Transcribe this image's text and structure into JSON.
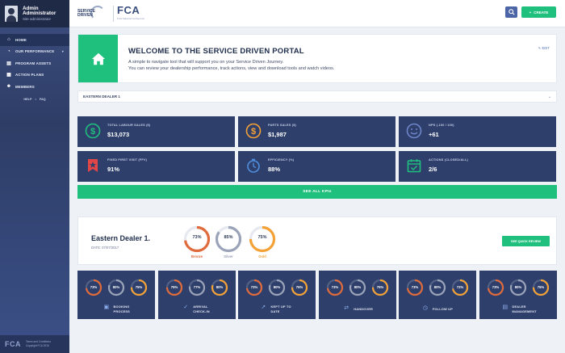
{
  "sidebar": {
    "user_name_line1": "Admin",
    "user_name_line2": "Administrator",
    "user_role": "Site administrator",
    "items": [
      {
        "label": "HOME",
        "icon": "home-icon"
      },
      {
        "label": "OUR PERFORMANCE",
        "icon": "performance-icon"
      },
      {
        "label": "PROGRAM ASSETS",
        "icon": "assets-icon"
      },
      {
        "label": "ACTION PLANS",
        "icon": "action-plans-icon"
      },
      {
        "label": "MEMBERS",
        "icon": "members-icon"
      }
    ],
    "help_label": "HELP",
    "help_separator": "•",
    "faq_label": "FAQ",
    "footer_logo": "FCA",
    "footer_terms": "Terms and Conditions",
    "footer_copyright": "Copyright FCA 2016"
  },
  "topbar": {
    "logo_line1": "SERVICE",
    "logo_line2": "DRIVEN",
    "fca_logo": "FCA",
    "fca_subtitle": "FCA National Conference",
    "create_label": "CREATE"
  },
  "welcome": {
    "title": "WELCOME TO THE SERVICE DRIVEN PORTAL",
    "line1": "A simple to navigate tool that will support you on your Service Driven Journey.",
    "line2": "You can review your dealership performance, track actions, view and download tools and watch videos.",
    "edit_label": "EDIT"
  },
  "dealer_select": {
    "value": "EASTERN DEALER 1"
  },
  "kpis": [
    {
      "label": "TOTAL LABOUR SALES ($)",
      "value": "$13,073",
      "icon": "dollar-green-icon"
    },
    {
      "label": "PARTS SALES ($)",
      "value": "$1,987",
      "icon": "dollar-orange-icon"
    },
    {
      "label": "NPS (-100 / 100)",
      "value": "+61",
      "icon": "smiley-icon"
    },
    {
      "label": "FIXED FIRST VISIT (FFV)",
      "value": "91%",
      "icon": "bookmark-star-icon"
    },
    {
      "label": "EFFICIENCY (%)",
      "value": "88%",
      "icon": "stopwatch-icon"
    },
    {
      "label": "ACTIONS (CLOSED/ALL)",
      "value": "2/6",
      "icon": "calendar-check-icon"
    }
  ],
  "see_all_label": "SEE ALL KPIs",
  "summary": {
    "dealer_name": "Eastern Dealer 1.",
    "date": "DATE: 07/07/2017",
    "medals": [
      {
        "pct": "73%",
        "label": "Bronze",
        "value": 0.73,
        "color": "#e06a3a"
      },
      {
        "pct": "85%",
        "label": "Silver",
        "value": 0.85,
        "color": "#9aa3b8"
      },
      {
        "pct": "75%",
        "label": "Gold",
        "value": 0.75,
        "color": "#f4a236"
      }
    ],
    "review_label": "SEE QUICK REVIEW"
  },
  "processes": [
    {
      "label1": "BOOKING",
      "label2": "PROCESS",
      "icon": "booking-icon",
      "rings": [
        {
          "pct": "73%",
          "value": 0.73
        },
        {
          "pct": "80%",
          "value": 0.8
        },
        {
          "pct": "75%",
          "value": 0.75
        }
      ]
    },
    {
      "label1": "ARRIVAL",
      "label2": "CHECK-IN",
      "icon": "checkin-icon",
      "rings": [
        {
          "pct": "75%",
          "value": 0.75
        },
        {
          "pct": "77%",
          "value": 0.77
        },
        {
          "pct": "80%",
          "value": 0.8
        }
      ]
    },
    {
      "label1": "KEPT UP TO",
      "label2": "DATE",
      "icon": "pointer-icon",
      "rings": [
        {
          "pct": "73%",
          "value": 0.73
        },
        {
          "pct": "80%",
          "value": 0.8
        },
        {
          "pct": "75%",
          "value": 0.75
        }
      ]
    },
    {
      "label1": "HANDOVER",
      "label2": "",
      "icon": "handover-icon",
      "rings": [
        {
          "pct": "73%",
          "value": 0.73
        },
        {
          "pct": "80%",
          "value": 0.8
        },
        {
          "pct": "75%",
          "value": 0.75
        }
      ]
    },
    {
      "label1": "FOLLOW UP",
      "label2": "",
      "icon": "follow-up-icon",
      "rings": [
        {
          "pct": "73%",
          "value": 0.73
        },
        {
          "pct": "80%",
          "value": 0.8
        },
        {
          "pct": "72%",
          "value": 0.72
        }
      ]
    },
    {
      "label1": "DEALER",
      "label2": "MANAGEMENT",
      "icon": "dealer-management-icon",
      "rings": [
        {
          "pct": "73%",
          "value": 0.73
        },
        {
          "pct": "80%",
          "value": 0.8
        },
        {
          "pct": "75%",
          "value": 0.75
        }
      ]
    }
  ],
  "colors": {
    "accent_green": "#1fc07e",
    "card_navy": "#2e3f6b",
    "ring_red": "#e06a3a",
    "ring_silver": "#9aa3b8",
    "ring_gold": "#f4a236"
  }
}
